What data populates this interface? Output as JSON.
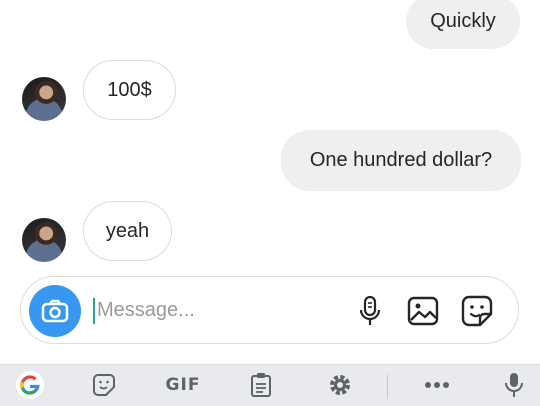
{
  "messages": [
    {
      "id": "m1",
      "direction": "outgoing",
      "text": "Quickly"
    },
    {
      "id": "m2",
      "direction": "incoming",
      "text": "100$"
    },
    {
      "id": "m3",
      "direction": "outgoing",
      "text": "One hundred dollar?"
    },
    {
      "id": "m4",
      "direction": "incoming",
      "text": "yeah"
    }
  ],
  "composer": {
    "placeholder": "Message..."
  },
  "keyboard_toolbar": {
    "items": [
      "google-icon",
      "sticker-icon",
      "gif",
      "clipboard-icon",
      "settings-icon",
      "more-icon",
      "mic-icon"
    ],
    "gif_label": "GIF"
  },
  "colors": {
    "camera_button": "#3897f0",
    "outgoing_bubble": "#efefef",
    "keyboard_bg": "#e8eaed"
  }
}
